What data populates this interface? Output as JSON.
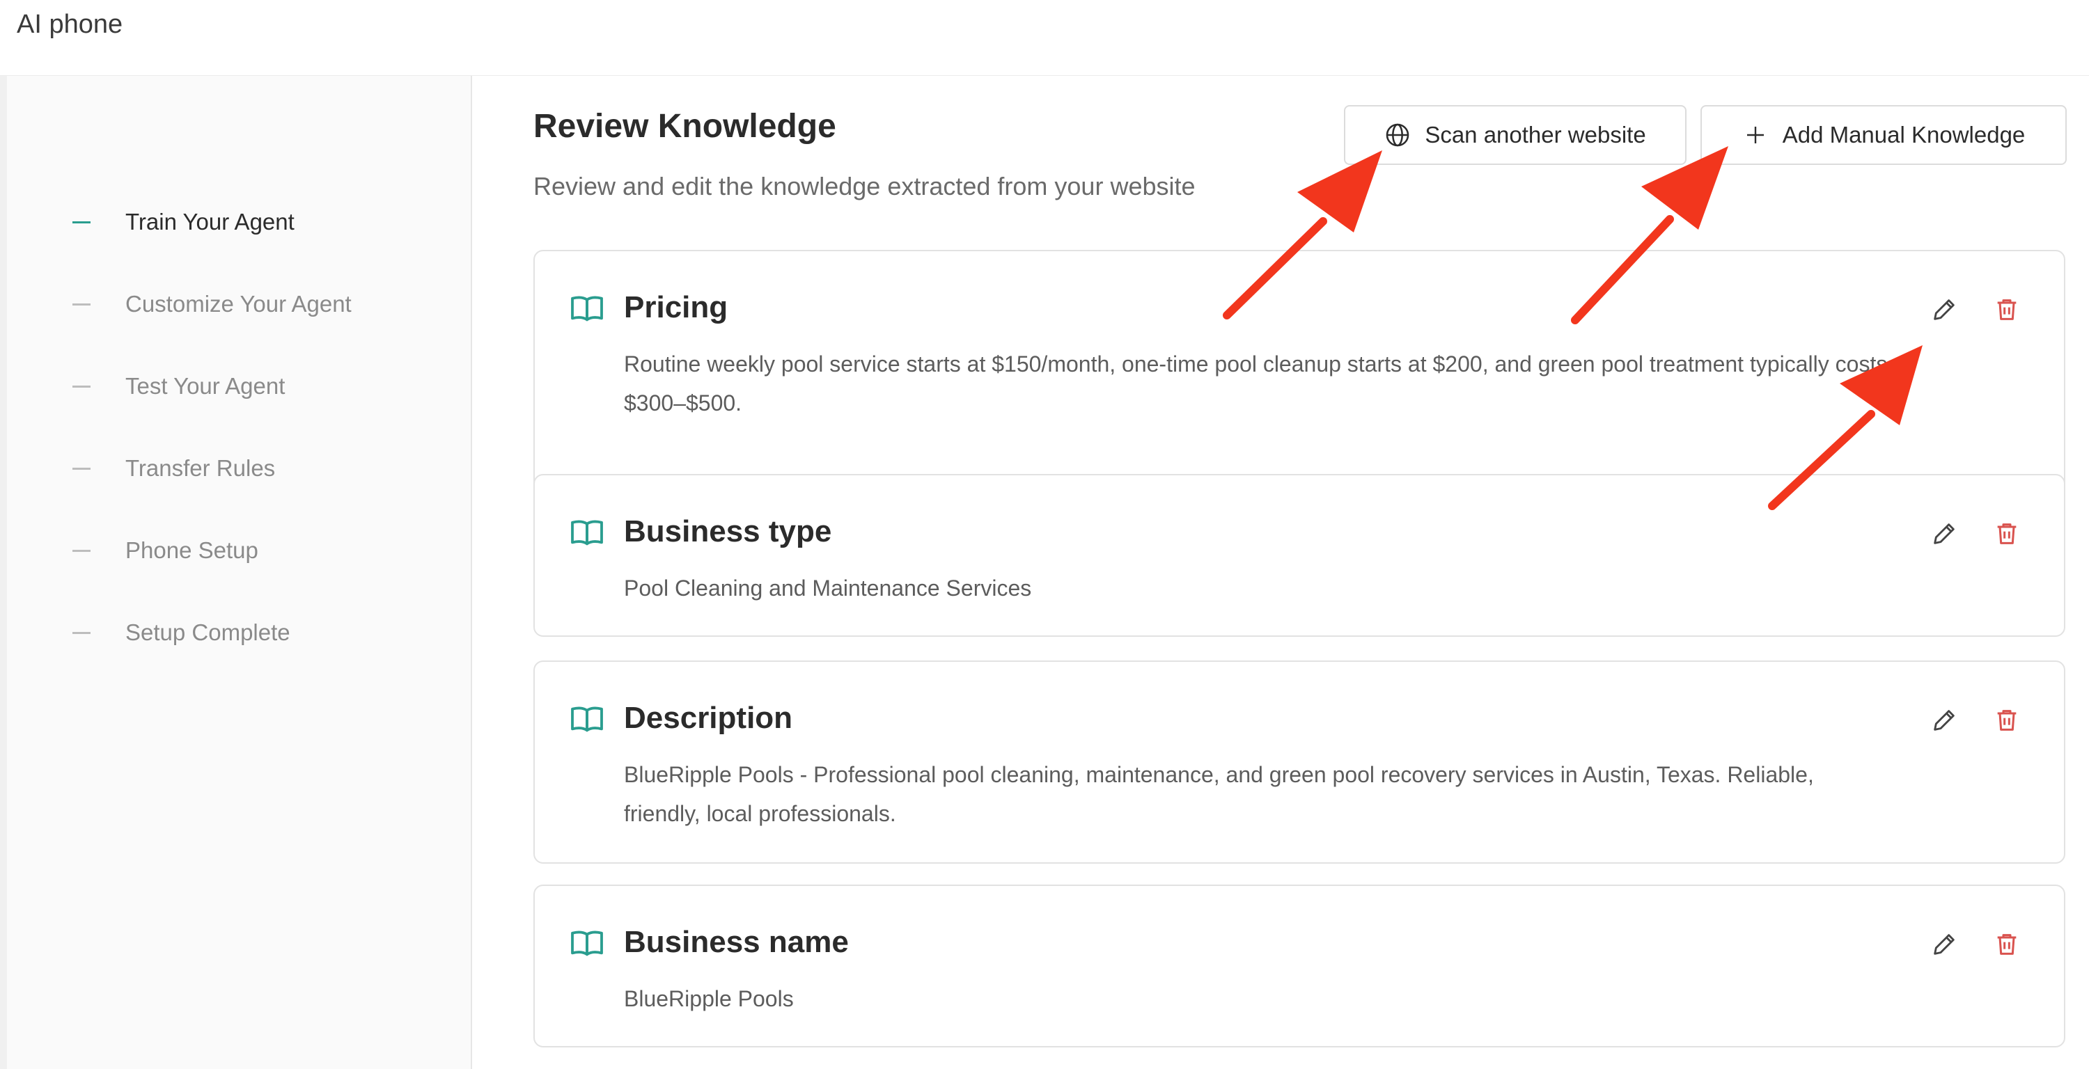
{
  "app": {
    "title": "AI phone"
  },
  "sidebar": {
    "steps": [
      {
        "label": "Train Your Agent",
        "active": true
      },
      {
        "label": "Customize Your Agent",
        "active": false
      },
      {
        "label": "Test Your Agent",
        "active": false
      },
      {
        "label": "Transfer Rules",
        "active": false
      },
      {
        "label": "Phone Setup",
        "active": false
      },
      {
        "label": "Setup Complete",
        "active": false
      }
    ]
  },
  "header": {
    "title": "Review Knowledge",
    "subtitle": "Review and edit the knowledge extracted from your website"
  },
  "actions": {
    "scan_label": "Scan another website",
    "scan_icon": "globe-icon",
    "add_label": "Add Manual Knowledge",
    "add_icon": "plus-icon"
  },
  "knowledge": [
    {
      "title": "Pricing",
      "body": "Routine weekly pool service starts at $150/month, one-time pool cleanup starts at $200, and green pool treatment typically costs $300–$500."
    },
    {
      "title": "Business type",
      "body": "Pool Cleaning and Maintenance Services"
    },
    {
      "title": "Description",
      "body": "BlueRipple Pools - Professional pool cleaning, maintenance, and green pool recovery services in Austin, Texas. Reliable, friendly, local professionals."
    },
    {
      "title": "Business name",
      "body": "BlueRipple Pools"
    }
  ],
  "colors": {
    "accent": "#2a9d8f",
    "delete": "#d9534f",
    "annotation_arrow": "#f2361d"
  }
}
